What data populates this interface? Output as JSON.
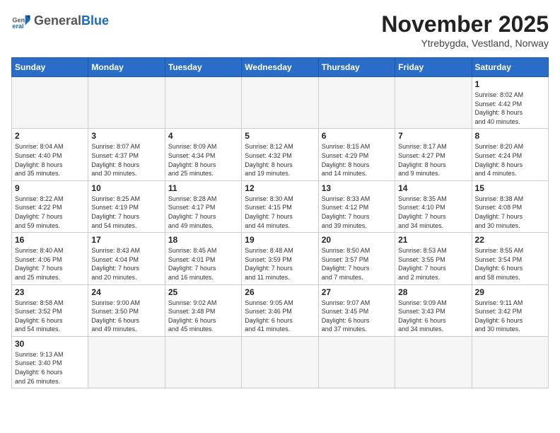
{
  "header": {
    "logo_general": "General",
    "logo_blue": "Blue",
    "month_title": "November 2025",
    "location": "Ytrebygda, Vestland, Norway"
  },
  "weekdays": [
    "Sunday",
    "Monday",
    "Tuesday",
    "Wednesday",
    "Thursday",
    "Friday",
    "Saturday"
  ],
  "days": [
    {
      "num": "",
      "info": ""
    },
    {
      "num": "",
      "info": ""
    },
    {
      "num": "",
      "info": ""
    },
    {
      "num": "",
      "info": ""
    },
    {
      "num": "",
      "info": ""
    },
    {
      "num": "",
      "info": ""
    },
    {
      "num": "1",
      "info": "Sunrise: 8:02 AM\nSunset: 4:42 PM\nDaylight: 8 hours\nand 40 minutes."
    },
    {
      "num": "2",
      "info": "Sunrise: 8:04 AM\nSunset: 4:40 PM\nDaylight: 8 hours\nand 35 minutes."
    },
    {
      "num": "3",
      "info": "Sunrise: 8:07 AM\nSunset: 4:37 PM\nDaylight: 8 hours\nand 30 minutes."
    },
    {
      "num": "4",
      "info": "Sunrise: 8:09 AM\nSunset: 4:34 PM\nDaylight: 8 hours\nand 25 minutes."
    },
    {
      "num": "5",
      "info": "Sunrise: 8:12 AM\nSunset: 4:32 PM\nDaylight: 8 hours\nand 19 minutes."
    },
    {
      "num": "6",
      "info": "Sunrise: 8:15 AM\nSunset: 4:29 PM\nDaylight: 8 hours\nand 14 minutes."
    },
    {
      "num": "7",
      "info": "Sunrise: 8:17 AM\nSunset: 4:27 PM\nDaylight: 8 hours\nand 9 minutes."
    },
    {
      "num": "8",
      "info": "Sunrise: 8:20 AM\nSunset: 4:24 PM\nDaylight: 8 hours\nand 4 minutes."
    },
    {
      "num": "9",
      "info": "Sunrise: 8:22 AM\nSunset: 4:22 PM\nDaylight: 7 hours\nand 59 minutes."
    },
    {
      "num": "10",
      "info": "Sunrise: 8:25 AM\nSunset: 4:19 PM\nDaylight: 7 hours\nand 54 minutes."
    },
    {
      "num": "11",
      "info": "Sunrise: 8:28 AM\nSunset: 4:17 PM\nDaylight: 7 hours\nand 49 minutes."
    },
    {
      "num": "12",
      "info": "Sunrise: 8:30 AM\nSunset: 4:15 PM\nDaylight: 7 hours\nand 44 minutes."
    },
    {
      "num": "13",
      "info": "Sunrise: 8:33 AM\nSunset: 4:12 PM\nDaylight: 7 hours\nand 39 minutes."
    },
    {
      "num": "14",
      "info": "Sunrise: 8:35 AM\nSunset: 4:10 PM\nDaylight: 7 hours\nand 34 minutes."
    },
    {
      "num": "15",
      "info": "Sunrise: 8:38 AM\nSunset: 4:08 PM\nDaylight: 7 hours\nand 30 minutes."
    },
    {
      "num": "16",
      "info": "Sunrise: 8:40 AM\nSunset: 4:06 PM\nDaylight: 7 hours\nand 25 minutes."
    },
    {
      "num": "17",
      "info": "Sunrise: 8:43 AM\nSunset: 4:04 PM\nDaylight: 7 hours\nand 20 minutes."
    },
    {
      "num": "18",
      "info": "Sunrise: 8:45 AM\nSunset: 4:01 PM\nDaylight: 7 hours\nand 16 minutes."
    },
    {
      "num": "19",
      "info": "Sunrise: 8:48 AM\nSunset: 3:59 PM\nDaylight: 7 hours\nand 11 minutes."
    },
    {
      "num": "20",
      "info": "Sunrise: 8:50 AM\nSunset: 3:57 PM\nDaylight: 7 hours\nand 7 minutes."
    },
    {
      "num": "21",
      "info": "Sunrise: 8:53 AM\nSunset: 3:55 PM\nDaylight: 7 hours\nand 2 minutes."
    },
    {
      "num": "22",
      "info": "Sunrise: 8:55 AM\nSunset: 3:54 PM\nDaylight: 6 hours\nand 58 minutes."
    },
    {
      "num": "23",
      "info": "Sunrise: 8:58 AM\nSunset: 3:52 PM\nDaylight: 6 hours\nand 54 minutes."
    },
    {
      "num": "24",
      "info": "Sunrise: 9:00 AM\nSunset: 3:50 PM\nDaylight: 6 hours\nand 49 minutes."
    },
    {
      "num": "25",
      "info": "Sunrise: 9:02 AM\nSunset: 3:48 PM\nDaylight: 6 hours\nand 45 minutes."
    },
    {
      "num": "26",
      "info": "Sunrise: 9:05 AM\nSunset: 3:46 PM\nDaylight: 6 hours\nand 41 minutes."
    },
    {
      "num": "27",
      "info": "Sunrise: 9:07 AM\nSunset: 3:45 PM\nDaylight: 6 hours\nand 37 minutes."
    },
    {
      "num": "28",
      "info": "Sunrise: 9:09 AM\nSunset: 3:43 PM\nDaylight: 6 hours\nand 34 minutes."
    },
    {
      "num": "29",
      "info": "Sunrise: 9:11 AM\nSunset: 3:42 PM\nDaylight: 6 hours\nand 30 minutes."
    },
    {
      "num": "30",
      "info": "Sunrise: 9:13 AM\nSunset: 3:40 PM\nDaylight: 6 hours\nand 26 minutes."
    },
    {
      "num": "",
      "info": ""
    },
    {
      "num": "",
      "info": ""
    },
    {
      "num": "",
      "info": ""
    },
    {
      "num": "",
      "info": ""
    },
    {
      "num": "",
      "info": ""
    },
    {
      "num": "",
      "info": ""
    }
  ]
}
